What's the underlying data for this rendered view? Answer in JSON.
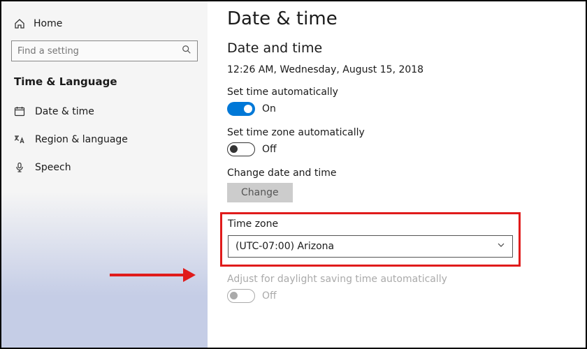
{
  "sidebar": {
    "home": "Home",
    "search_placeholder": "Find a setting",
    "section": "Time & Language",
    "items": [
      {
        "label": "Date & time"
      },
      {
        "label": "Region & language"
      },
      {
        "label": "Speech"
      }
    ]
  },
  "main": {
    "title": "Date & time",
    "group_title": "Date and time",
    "clock_text": "12:26 AM, Wednesday, August 15, 2018",
    "set_time_auto": {
      "label": "Set time automatically",
      "state": "On",
      "on": true
    },
    "set_tz_auto": {
      "label": "Set time zone automatically",
      "state": "Off",
      "on": false
    },
    "change_section": {
      "label": "Change date and time",
      "button": "Change"
    },
    "timezone": {
      "label": "Time zone",
      "value": "(UTC-07:00) Arizona"
    },
    "dst": {
      "label": "Adjust for daylight saving time automatically",
      "state": "Off"
    }
  }
}
